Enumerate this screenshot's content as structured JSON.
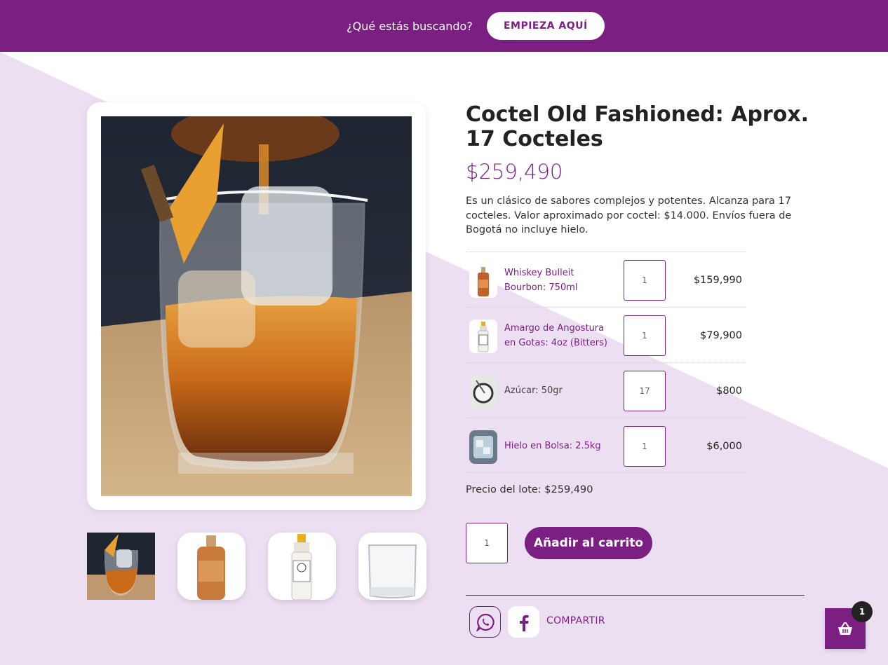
{
  "colors": {
    "brand": "#7b2082",
    "bg_light": "#ecdff2",
    "white": "#ffffff"
  },
  "topbar": {
    "question": "¿Qué estás buscando?",
    "cta_label": "EMPIEZA AQUÍ"
  },
  "product": {
    "title": "Coctel Old Fashioned: Aprox. 17 Cocteles",
    "price": "$259,490",
    "description": "Es un clásico de sabores complejos y potentes. Alcanza para 17 cocteles. Valor aproximado por coctel: $14.000. Envíos fuera de Bogotá no incluye hielo."
  },
  "bundle_items": [
    {
      "name": "Whiskey Bulleit Bourbon: 750ml",
      "qty": "1",
      "price": "$159,990",
      "icon": "whiskey-bottle-icon"
    },
    {
      "name": "Amargo de Angostura en Gotas: 4oz (Bitters)",
      "qty": "1",
      "price": "$79,900",
      "icon": "bitters-bottle-icon"
    },
    {
      "name": "Azúcar: 50gr",
      "qty": "17",
      "price": "$800",
      "icon": "sugar-icon"
    },
    {
      "name": "Hielo en Bolsa: 2.5kg",
      "qty": "1",
      "price": "$6,000",
      "icon": "ice-bag-icon"
    }
  ],
  "lot_price": "Precio del lote: $259,490",
  "cart": {
    "qty": "1",
    "add_label": "Añadir al carrito",
    "badge_count": "1"
  },
  "share": {
    "label": "COMPARTIR"
  }
}
